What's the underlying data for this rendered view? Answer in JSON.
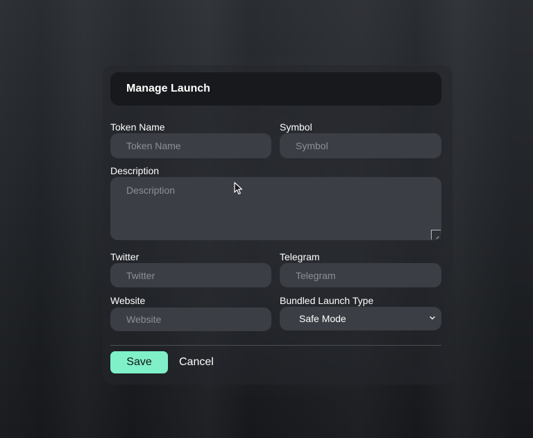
{
  "dialog": {
    "title": "Manage Launch"
  },
  "form": {
    "token_name": {
      "label": "Token Name",
      "placeholder": "Token Name",
      "value": ""
    },
    "symbol": {
      "label": "Symbol",
      "placeholder": "Symbol",
      "value": ""
    },
    "description": {
      "label": "Description",
      "placeholder": "Description",
      "value": ""
    },
    "twitter": {
      "label": "Twitter",
      "placeholder": "Twitter",
      "value": ""
    },
    "telegram": {
      "label": "Telegram",
      "placeholder": "Telegram",
      "value": ""
    },
    "website": {
      "label": "Website",
      "placeholder": "Website",
      "value": ""
    },
    "bundled_launch_type": {
      "label": "Bundled Launch Type",
      "selected": "Safe Mode"
    }
  },
  "actions": {
    "save_label": "Save",
    "cancel_label": "Cancel"
  },
  "colors": {
    "accent": "#7ff0c8",
    "field_bg": "#3b3e44",
    "header_bg": "#18191c",
    "placeholder": "#8d9097"
  },
  "icons": {
    "select_indicator": "chevron-down-icon",
    "cursor": "cursor-icon",
    "resize": "resize-handle-icon"
  }
}
